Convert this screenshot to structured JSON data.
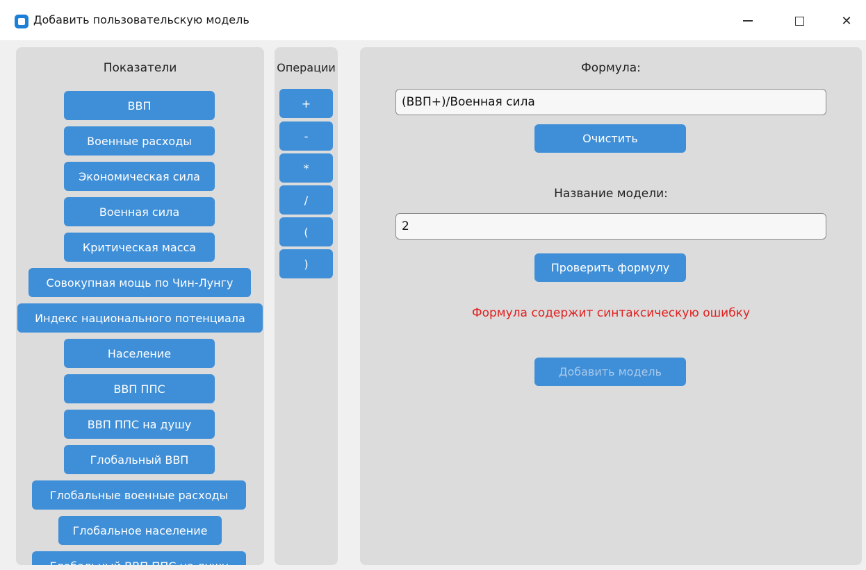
{
  "window": {
    "title": "Добавить пользовательскую модель",
    "minimize_glyph": "—",
    "maximize_glyph": "☐",
    "close_glyph": "✕"
  },
  "indicators": {
    "heading": "Показатели",
    "items": [
      "ВВП",
      "Военные расходы",
      "Экономическая сила",
      "Военная сила",
      "Критическая масса",
      "Совокупная мощь по Чин-Лунгу",
      "Индекс национального потенциала",
      "Население",
      "ВВП ППС",
      "ВВП ППС на душу",
      "Глобальный ВВП",
      "Глобальные военные расходы",
      "Глобальное население",
      "Глобальный ВВП ППС на душу"
    ]
  },
  "operations": {
    "heading": "Операции",
    "items": [
      "+",
      "-",
      "*",
      "/",
      "(",
      ")"
    ]
  },
  "formula_panel": {
    "formula_label": "Формула:",
    "formula_value": "(ВВП+)/Военная сила",
    "clear_button": "Очистить",
    "model_name_label": "Название модели:",
    "model_name_value": "2",
    "check_button": "Проверить формулу",
    "error_message": "Формула содержит синтаксическую ошибку",
    "add_button": "Добавить модель",
    "add_button_enabled": false
  },
  "colors": {
    "accent": "#3f8fd8",
    "panel_bg": "#dcdcdc",
    "error": "#e0201f"
  }
}
